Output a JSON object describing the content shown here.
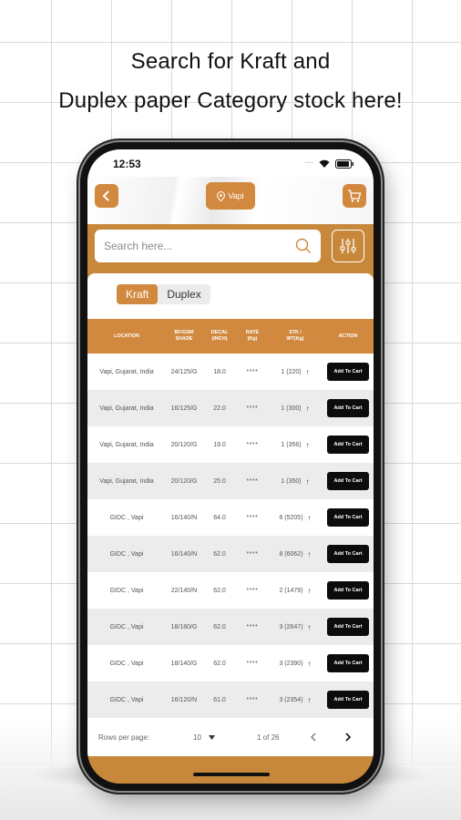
{
  "headline": {
    "line1": "Search for Kraft and",
    "line2": "Duplex paper Category stock here!"
  },
  "status": {
    "time": "12:53"
  },
  "appbar": {
    "location": "Vapi",
    "icons": [
      "back-arrow-icon",
      "location-pin-icon",
      "cart-icon"
    ]
  },
  "search": {
    "placeholder": "Search here..."
  },
  "tabs": {
    "kraft": "Kraft",
    "duplex": "Duplex",
    "selected": "Kraft"
  },
  "table": {
    "headers": {
      "location": "LOCATION",
      "bf1": "BF/GSM",
      "bf2": "SHADE",
      "decal1": "DECAL",
      "decal2": "(INCH)",
      "rate1": "RATE",
      "rate2": "(Kg)",
      "stk1": "STK /",
      "stk2": "WT(Kg)",
      "action": "ACTION"
    },
    "action_label": "Add To Cart",
    "rows": [
      {
        "location": "Vapi, Gujarat, India",
        "bf": "24/125/G",
        "decal": "18.0",
        "rate": "****",
        "stk": "1 (220)"
      },
      {
        "location": "Vapi, Gujarat, India",
        "bf": "16/125/G",
        "decal": "22.0",
        "rate": "****",
        "stk": "1 (300)"
      },
      {
        "location": "Vapi, Gujarat, India",
        "bf": "20/120/G",
        "decal": "19.0",
        "rate": "****",
        "stk": "1 (356)"
      },
      {
        "location": "Vapi, Gujarat, India",
        "bf": "20/120/G",
        "decal": "25.0",
        "rate": "****",
        "stk": "1 (350)"
      },
      {
        "location": "GIDC , Vapi",
        "bf": "16/140/N",
        "decal": "64.0",
        "rate": "****",
        "stk": "6 (5205)"
      },
      {
        "location": "GIDC , Vapi",
        "bf": "16/140/N",
        "decal": "62.0",
        "rate": "****",
        "stk": "8 (6062)"
      },
      {
        "location": "GIDC , Vapi",
        "bf": "22/140/N",
        "decal": "62.0",
        "rate": "****",
        "stk": "2 (1479)"
      },
      {
        "location": "GIDC , Vapi",
        "bf": "18/180/G",
        "decal": "62.0",
        "rate": "****",
        "stk": "3 (2647)"
      },
      {
        "location": "GIDC , Vapi",
        "bf": "18/140/G",
        "decal": "62.0",
        "rate": "****",
        "stk": "3 (2390)"
      },
      {
        "location": "GIDC , Vapi",
        "bf": "16/120/N",
        "decal": "61.0",
        "rate": "****",
        "stk": "3 (2354)"
      }
    ]
  },
  "pagination": {
    "rows_per_page_label": "Rows per page:",
    "rows_per_page_value": "10",
    "range": "1 of 26"
  },
  "colors": {
    "accent": "#d1893f",
    "background_band": "#c8883c",
    "button_dark": "#0c0c0c"
  }
}
